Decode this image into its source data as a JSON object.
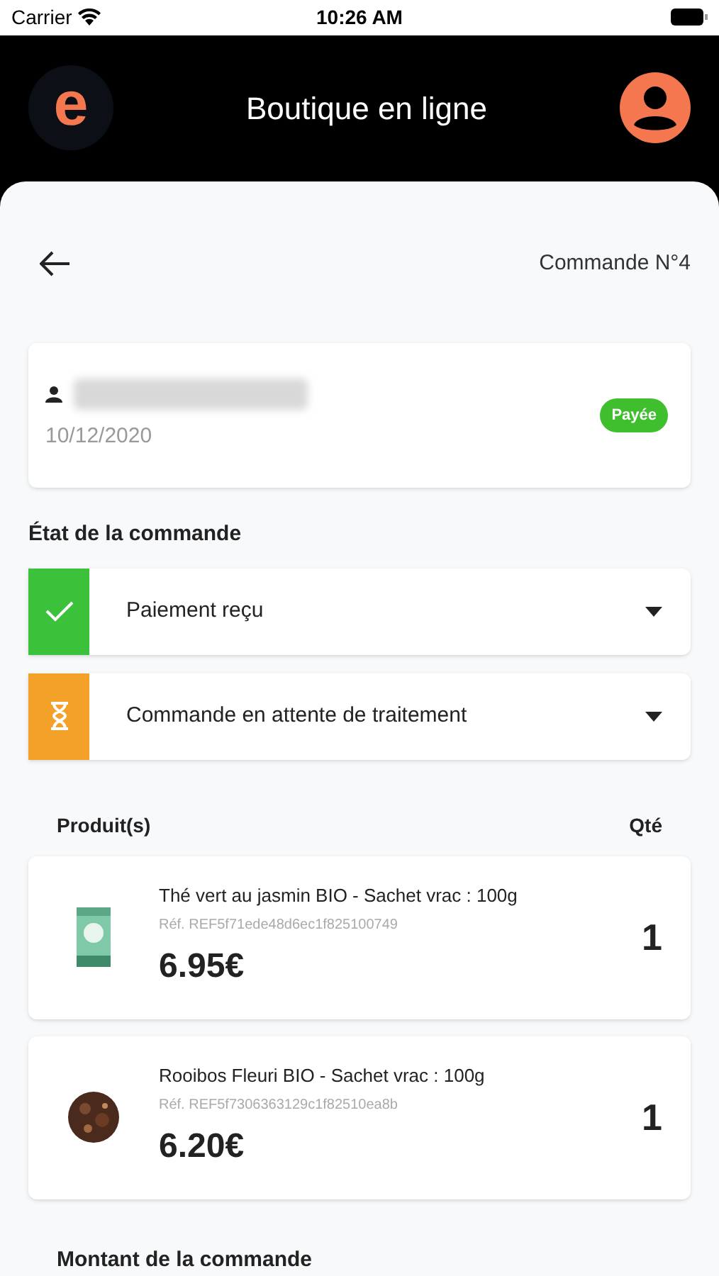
{
  "status_bar": {
    "carrier": "Carrier",
    "time": "10:26 AM"
  },
  "header": {
    "title": "Boutique en ligne",
    "logo": "e"
  },
  "page": {
    "title": "Commande N°4"
  },
  "order": {
    "date": "10/12/2020",
    "status": {
      "label": "Payée",
      "color": "#3fbf2e"
    }
  },
  "steps_title": "État de la commande",
  "steps": [
    {
      "kind": "done",
      "label": "Paiement reçu",
      "color": "#3cc13b",
      "expanded": false
    },
    {
      "kind": "pending",
      "label": "Commande en attente de traitement",
      "color": "#f4a12a",
      "expanded": false
    }
  ],
  "products_header": {
    "product": "Produit(s)",
    "qty": "Qté"
  },
  "products": [
    {
      "kind": "tea-bag",
      "name": "Thé vert au jasmin BIO - Sachet vrac : 100g",
      "ref": "Réf. REF5f71ede48d6ec1f825100749",
      "price": "6.95€",
      "qty": "1"
    },
    {
      "kind": "loose-tea",
      "name": "Rooibos Fleuri BIO - Sachet vrac : 100g",
      "ref": "Réf. REF5f7306363129c1f82510ea8b",
      "price": "6.20€",
      "qty": "1"
    }
  ],
  "total_title": "Montant de la commande"
}
